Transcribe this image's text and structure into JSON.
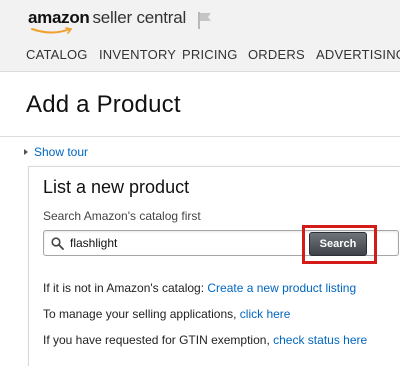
{
  "header": {
    "logo_brand": "amazon",
    "logo_product": "seller central",
    "flag_icon": "flag-icon"
  },
  "nav": {
    "items": [
      {
        "label": "CATALOG"
      },
      {
        "label": "INVENTORY"
      },
      {
        "label": "PRICING"
      },
      {
        "label": "ORDERS"
      },
      {
        "label": "ADVERTISING"
      }
    ]
  },
  "page": {
    "title": "Add a Product",
    "show_tour": "Show tour"
  },
  "card": {
    "title": "List a new product",
    "subtitle": "Search Amazon's catalog first",
    "search": {
      "value": "flashlight",
      "button_label": "Search",
      "icon": "search-icon"
    },
    "lines": [
      {
        "text": "If it is not in Amazon's catalog:",
        "link": "Create a new product listing"
      },
      {
        "text": "To manage your selling applications,",
        "link": "click here"
      },
      {
        "text": "If you have requested for GTIN exemption,",
        "link": "check status here"
      }
    ]
  },
  "colors": {
    "link": "#0066c0",
    "highlight": "#d51a1a",
    "button": "#4a4e54"
  }
}
